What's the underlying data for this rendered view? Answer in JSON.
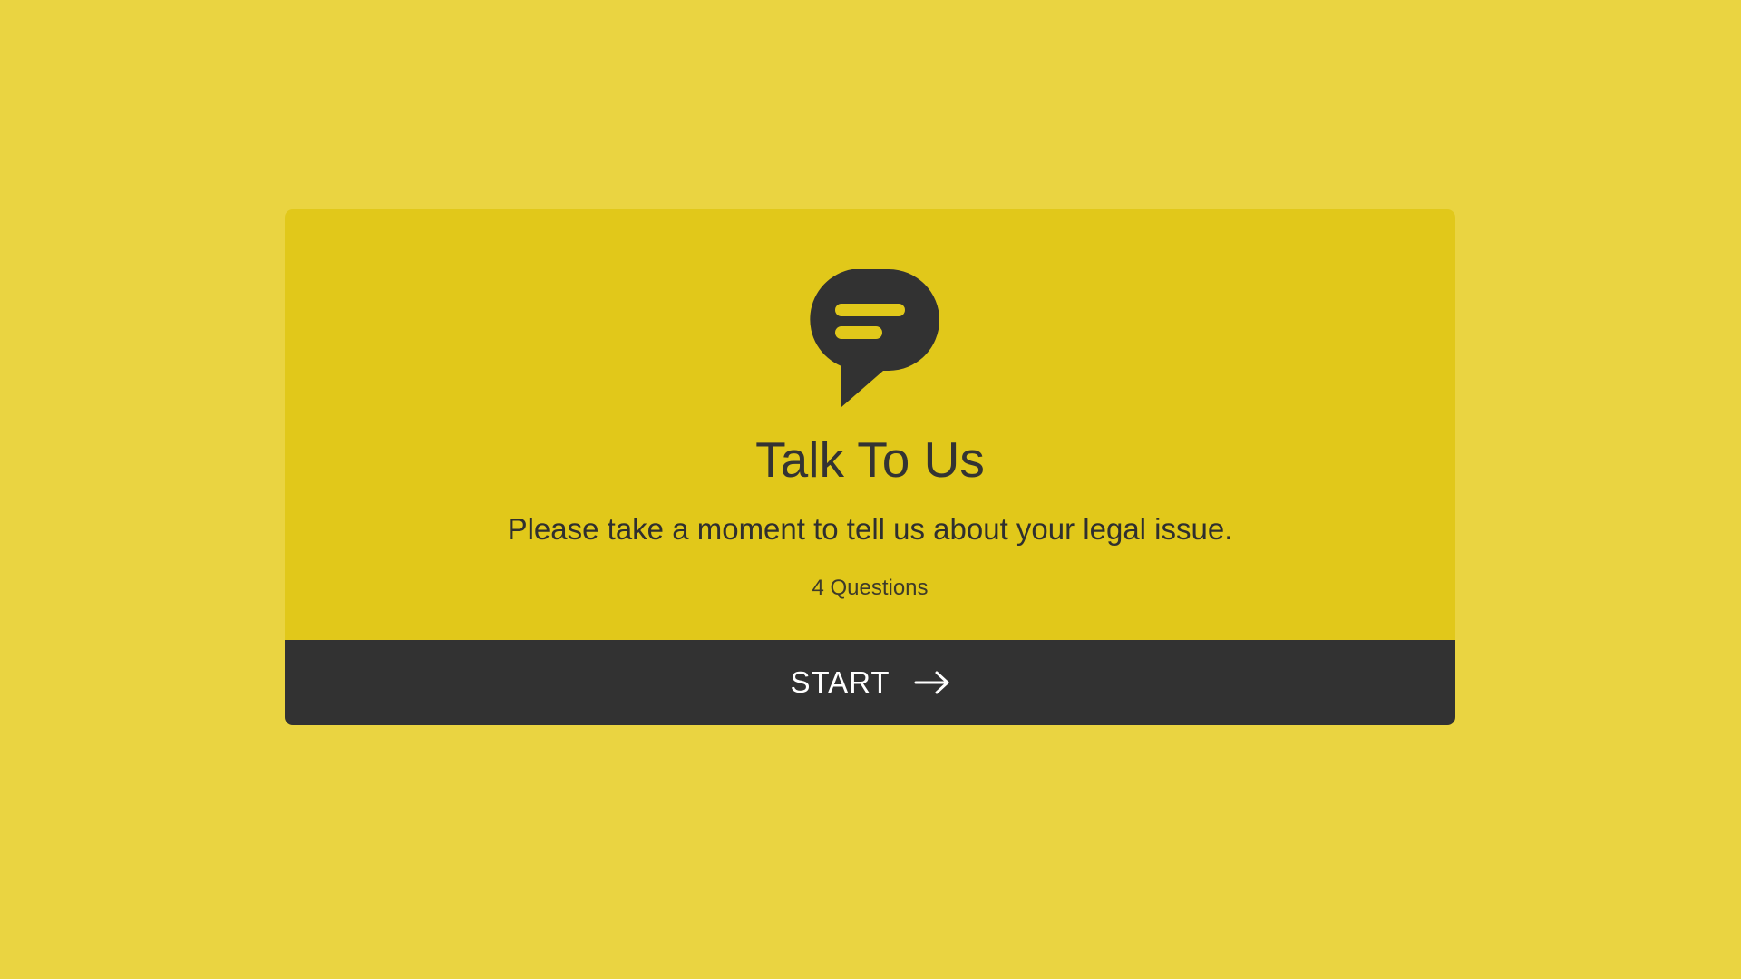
{
  "colors": {
    "page_background": "#EAD441",
    "card_background": "#E1C81A",
    "dark": "#323232",
    "button_text": "#FFFFFF"
  },
  "card": {
    "icon": "chat-bubble-icon",
    "title": "Talk To Us",
    "subtitle": "Please take a moment to tell us about your legal issue.",
    "question_count": "4 Questions"
  },
  "start_button": {
    "label": "START",
    "icon": "arrow-right-icon"
  }
}
